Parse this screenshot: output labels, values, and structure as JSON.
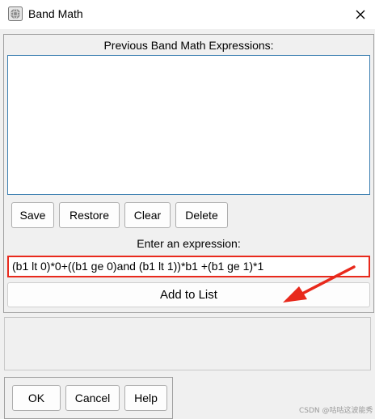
{
  "window": {
    "title": "Band Math"
  },
  "previous": {
    "label": "Previous Band Math Expressions:"
  },
  "list_buttons": {
    "save": "Save",
    "restore": "Restore",
    "clear": "Clear",
    "delete": "Delete"
  },
  "expression": {
    "label": "Enter an expression:",
    "value": "(b1 lt 0)*0+((b1 ge 0)and (b1 lt 1))*b1 +(b1 ge 1)*1"
  },
  "add_to_list": "Add to List",
  "dialog_buttons": {
    "ok": "OK",
    "cancel": "Cancel",
    "help": "Help"
  },
  "watermark": "CSDN @咕咕这波能秀",
  "colors": {
    "highlight_border": "#e8291c",
    "arrow": "#e8291c",
    "list_border": "#3c7fb1"
  },
  "icons": {
    "app": "envi-globe-icon",
    "close": "close-icon"
  }
}
